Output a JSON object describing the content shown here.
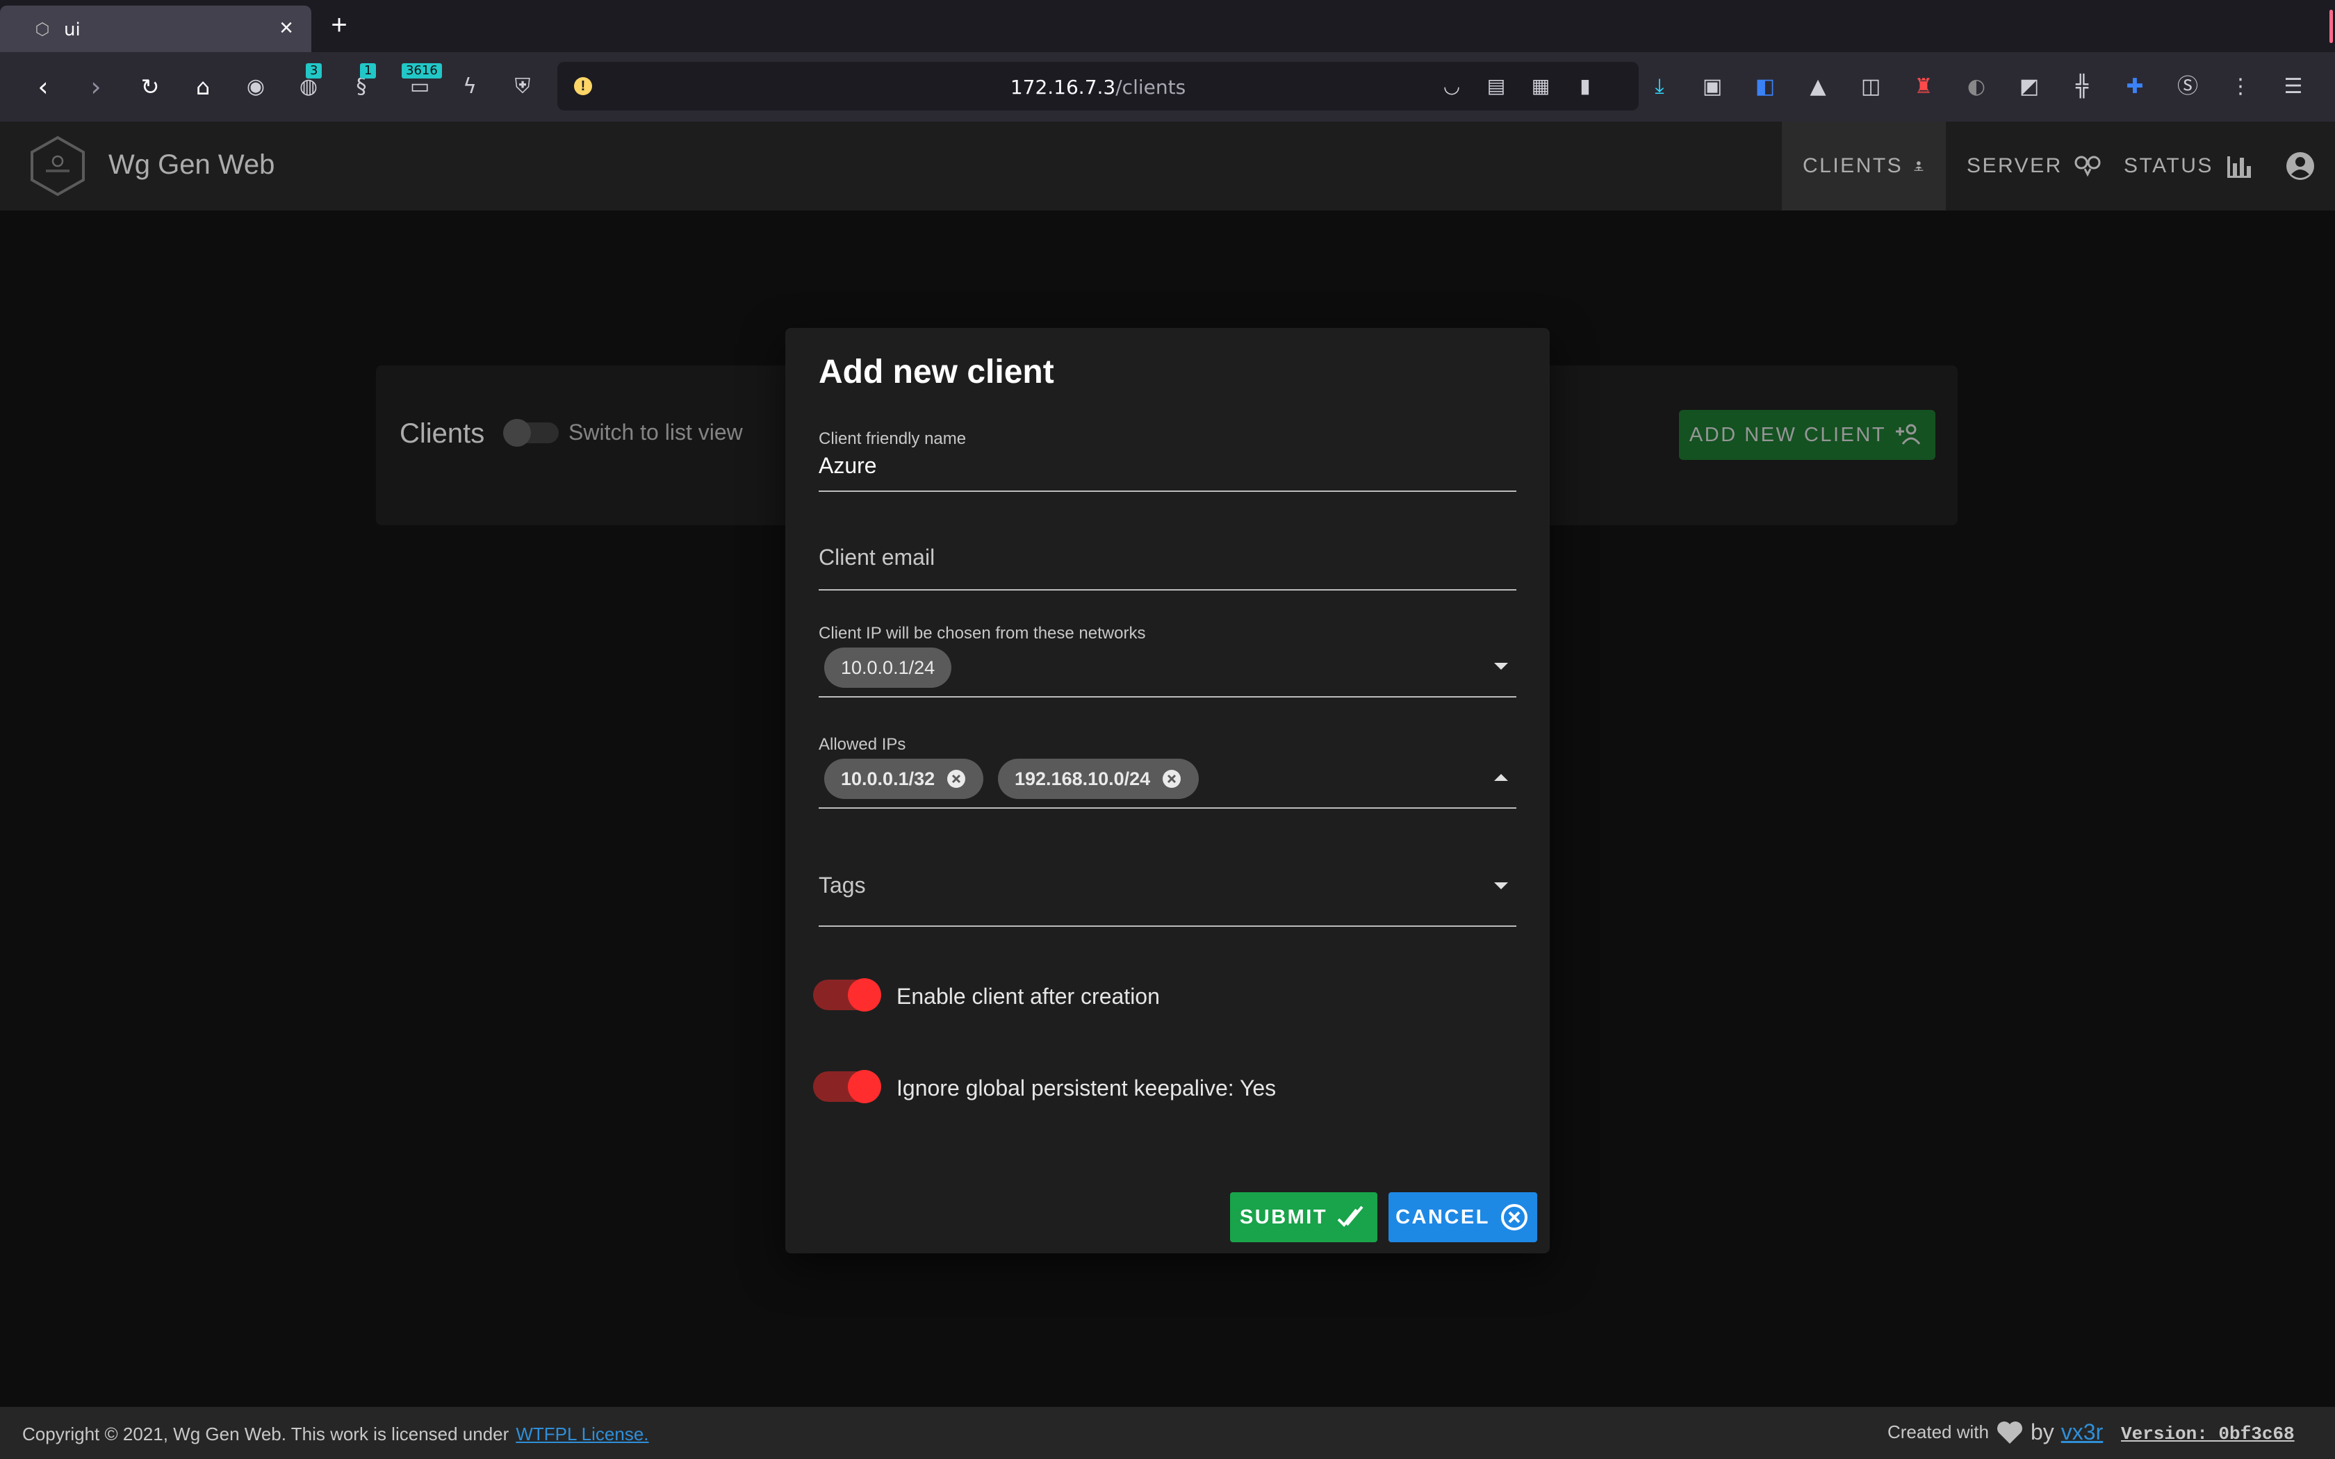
{
  "browser": {
    "tab_title": "ui",
    "url_host": "172.16.7.3",
    "url_path": "/clients",
    "badges": [
      "3",
      "1",
      "3616"
    ]
  },
  "app": {
    "title": "Wg Gen Web",
    "nav": [
      {
        "label": "CLIENTS",
        "icon": "person-network-icon",
        "active": true
      },
      {
        "label": "SERVER",
        "icon": "server-link-icon",
        "active": false
      },
      {
        "label": "STATUS",
        "icon": "bar-chart-icon",
        "active": false
      }
    ],
    "account_icon": "account-circle-icon"
  },
  "page": {
    "title": "Clients",
    "switch_label": "Switch to list view",
    "add_button_label": "ADD NEW CLIENT"
  },
  "dialog": {
    "title": "Add new client",
    "name_label": "Client friendly name",
    "name_value": "Azure",
    "email_placeholder": "Client email",
    "networks_label": "Client IP will be chosen from these networks",
    "networks": [
      "10.0.0.1/24"
    ],
    "allowed_label": "Allowed IPs",
    "allowed_ips": [
      "10.0.0.1/32",
      "192.168.10.0/24"
    ],
    "tags_placeholder": "Tags",
    "enable_label": "Enable client after creation",
    "enable_on": true,
    "keepalive_label": "Ignore global persistent keepalive: Yes",
    "keepalive_on": true,
    "submit_label": "SUBMIT",
    "cancel_label": "CANCEL"
  },
  "colors": {
    "submit": "#19a34a",
    "cancel": "#1e88e5",
    "toggle_on": "#ff2d2d",
    "add_client": "#1b6e2c"
  },
  "footer": {
    "copyright": "Copyright © 2021, Wg Gen Web. This work is licensed under",
    "license_link": "WTFPL License.",
    "created_with": "Created with",
    "by": "by",
    "author": "vx3r",
    "version": "Version: 0bf3c68"
  }
}
